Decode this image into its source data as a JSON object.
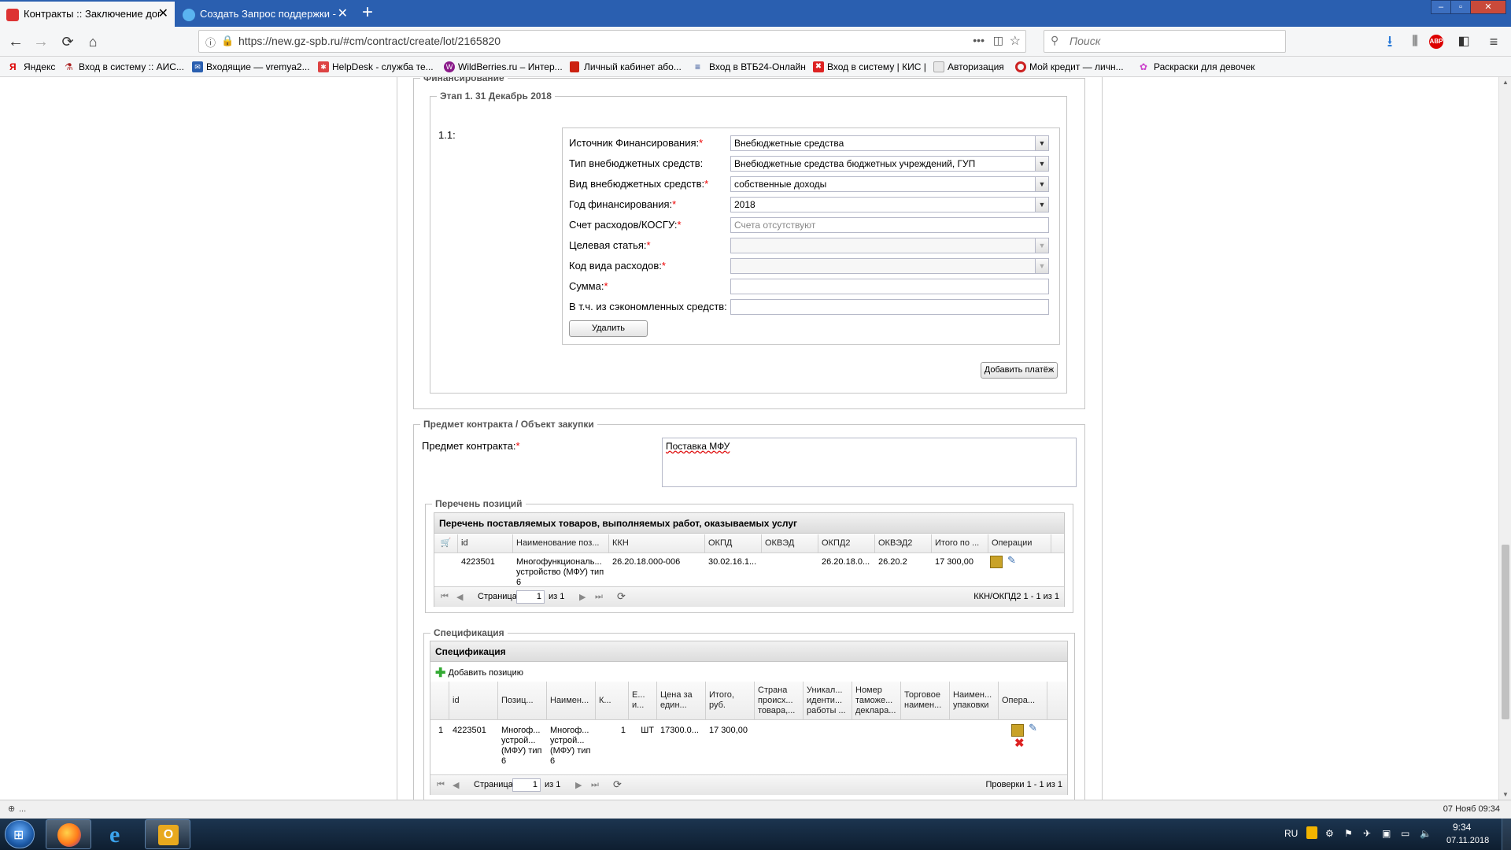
{
  "browser": {
    "tabs": [
      {
        "title": "Контракты :: Заключение дог",
        "active": true
      },
      {
        "title": "Создать Запрос поддержки - ",
        "active": false
      }
    ],
    "url": "https://new.gz-spb.ru/#cm/contract/create/lot/2165820",
    "search_placeholder": "Поиск",
    "bookmarks": [
      "Яндекс",
      "Вход в систему :: АИС...",
      "Входящие — vremya2...",
      "HelpDesk - служба те...",
      "WildBerries.ru – Интер...",
      "Личный кабинет або...",
      "Вход в ВТБ24-Онлайн",
      "Вход в систему | КИС |",
      "Авторизация",
      "Мой кредит — личн...",
      "Раскраски для девочек"
    ]
  },
  "financing": {
    "legend": "Финансирование",
    "stage_legend": "Этап 1. 31 Декабрь 2018",
    "item_num": "1.1:",
    "fields": [
      {
        "label": "Источник Финансирования:",
        "required": "*",
        "value": "Внебюджетные средства",
        "type": "select"
      },
      {
        "label": "Тип внебюджетных средств:",
        "required": "",
        "value": "Внебюджетные средства бюджетных учреждений, ГУП",
        "type": "select"
      },
      {
        "label": "Вид внебюджетных средств:",
        "required": "*",
        "value": "собственные доходы",
        "type": "select"
      },
      {
        "label": "Год финансирования:",
        "required": "*",
        "value": "2018",
        "type": "select"
      },
      {
        "label": "Счет расходов/КОСГУ:",
        "required": "*",
        "value": "Счета отсутствуют",
        "type": "input-placeholder"
      },
      {
        "label": "Целевая статья:",
        "required": "*",
        "value": "",
        "type": "select-disabled"
      },
      {
        "label": "Код вида расходов:",
        "required": "*",
        "value": "",
        "type": "select-disabled"
      },
      {
        "label": "Сумма:",
        "required": "*",
        "value": "",
        "type": "input"
      },
      {
        "label": "В т.ч. из сэкономленных средств:",
        "required": "",
        "value": "",
        "type": "input"
      }
    ],
    "delete_label": "Удалить",
    "add_payment_label": "Добавить платёж"
  },
  "subject": {
    "legend": "Предмет контракта / Объект закупки",
    "label": "Предмет контракта:",
    "required": "*",
    "value": "Поставка МФУ"
  },
  "positions": {
    "legend": "Перечень позиций",
    "title": "Перечень поставляемых товаров, выполняемых работ, оказываемых услуг",
    "headers": [
      "id",
      "Наименование поз...",
      "ККН",
      "ОКПД",
      "ОКВЭД",
      "ОКПД2",
      "ОКВЭД2",
      "Итого по ...",
      "Операции"
    ],
    "rows": [
      {
        "id": "4223501",
        "name": "Многофункциональ... устройство (МФУ) тип 6",
        "kkn": "26.20.18.000-006",
        "okpd": "30.02.16.1...",
        "okved": "",
        "okpd2": "26.20.18.0...",
        "okved2": "26.20.2",
        "total": "17 300,00"
      }
    ],
    "pager": {
      "page_label": "Страница",
      "page": "1",
      "of_label": "из 1",
      "info": "ККН/ОКПД2 1 - 1 из 1"
    }
  },
  "spec": {
    "legend": "Спецификация",
    "title": "Спецификация",
    "add_label": "Добавить позицию",
    "headers": [
      "id",
      "Позиц...",
      "Наимен...",
      "К...",
      "Е... и...",
      "Цена за един...",
      "Итого, руб.",
      "Страна происх... товара,...",
      "Уникал... иденти... работы ...",
      "Номер таможе... деклара...",
      "Торговое наимен...",
      "Наимен... упаковки",
      "Опера..."
    ],
    "rows": [
      {
        "num": "1",
        "id": "4223501",
        "pos": "Многоф... устрой... (МФУ) тип 6",
        "name": "Многоф... устрой... (МФУ) тип 6",
        "qty": "1",
        "unit": "ШТ",
        "price": "17300.0...",
        "total": "17 300,00"
      }
    ],
    "pager": {
      "page_label": "Страница",
      "page": "1",
      "of_label": "из 1",
      "info": "Проверки 1 - 1 из 1"
    }
  },
  "statusbar": {
    "left": "...",
    "right": "07 Нояб 09:34"
  },
  "taskbar": {
    "lang": "RU",
    "time": "9:34",
    "date": "07.11.2018"
  }
}
